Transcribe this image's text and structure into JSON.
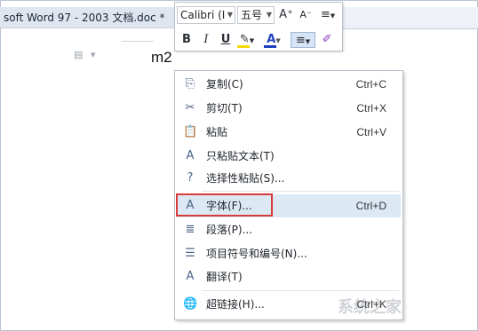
{
  "window": {
    "tab_title": "soft Word 97 - 2003 文档.doc *"
  },
  "document": {
    "text": "m2"
  },
  "mini_toolbar": {
    "font_name": "Calibri (I",
    "font_size": "五号",
    "grow_font": "A⁺",
    "shrink_font": "A⁻",
    "line_spacing": "≡",
    "bold": "B",
    "italic": "I",
    "underline": "U",
    "highlight": "✎",
    "font_color": "A",
    "align": "≡",
    "format_painter": "✐",
    "font_color_swatch": "#1f3fbf",
    "highlight_swatch": "#f5d800"
  },
  "context_menu": {
    "items": [
      {
        "label": "复制(C)",
        "shortcut": "Ctrl+C",
        "icon": "copy-icon",
        "glyph": "⎘"
      },
      {
        "label": "剪切(T)",
        "shortcut": "Ctrl+X",
        "icon": "scissors-icon",
        "glyph": "✂"
      },
      {
        "label": "粘贴",
        "shortcut": "Ctrl+V",
        "icon": "paste-icon",
        "glyph": "📋"
      },
      {
        "label": "只粘贴文本(T)",
        "shortcut": "",
        "icon": "paste-text-icon",
        "glyph": "A"
      },
      {
        "label": "选择性粘贴(S)...",
        "shortcut": "",
        "icon": "paste-special-icon",
        "glyph": "?"
      },
      {
        "label": "字体(F)...",
        "shortcut": "Ctrl+D",
        "icon": "font-icon",
        "glyph": "A"
      },
      {
        "label": "段落(P)...",
        "shortcut": "",
        "icon": "paragraph-icon",
        "glyph": "≣"
      },
      {
        "label": "项目符号和编号(N)...",
        "shortcut": "",
        "icon": "bullets-icon",
        "glyph": "☰"
      },
      {
        "label": "翻译(T)",
        "shortcut": "",
        "icon": "translate-icon",
        "glyph": "A"
      },
      {
        "label": "超链接(H)...",
        "shortcut": "Ctrl+K",
        "icon": "hyperlink-icon",
        "glyph": "🌐"
      }
    ]
  },
  "highlight_color": "#d93b3b",
  "watermark": "系统之家"
}
